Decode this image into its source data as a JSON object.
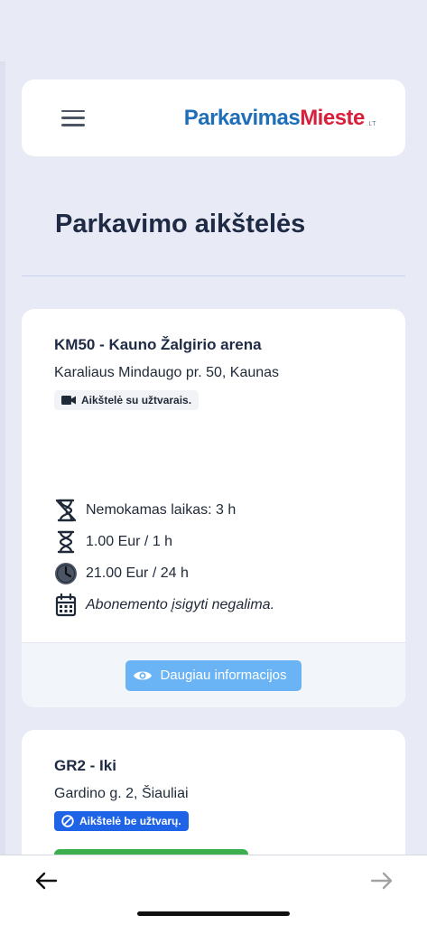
{
  "header": {
    "logo_part1": "Parkavimas",
    "logo_part2": "Mieste",
    "logo_part3": ".LT"
  },
  "page": {
    "title": "Parkavimo aikštelės"
  },
  "lots": [
    {
      "title": "KM50 - Kauno Žalgirio arena",
      "address": "Karaliaus Mindaugo pr. 50, Kaunas",
      "badge": "Aikštelė su užtvarais.",
      "info": {
        "free_time": "Nemokamas laikas: 3 h",
        "hourly": "1.00 Eur / 1 h",
        "daily": "21.00 Eur / 24 h",
        "subscription": "Abonemento įsigyti negalima."
      },
      "more_label": "Daugiau informacijos"
    },
    {
      "title": "GR2 - Iki",
      "address": "Gardino g. 2, Šiauliai",
      "badge": "Aikštelė be užtvarų."
    }
  ],
  "colors": {
    "logo_blue": "#1e6fb8",
    "logo_red": "#d81f3b",
    "badge_blue": "#1f63e6",
    "more_button": "#6ab4f5",
    "green": "#3dae4e"
  },
  "icons": {
    "menu": "hamburger-icon",
    "camera": "video-camera-icon",
    "no_entry": "no-entry-icon",
    "free_time": "hourglass-off-icon",
    "hourly": "hourglass-icon",
    "daily": "clock-icon",
    "subscription": "calendar-icon",
    "eye": "eye-icon",
    "back": "arrow-left-icon",
    "forward": "arrow-right-icon"
  }
}
